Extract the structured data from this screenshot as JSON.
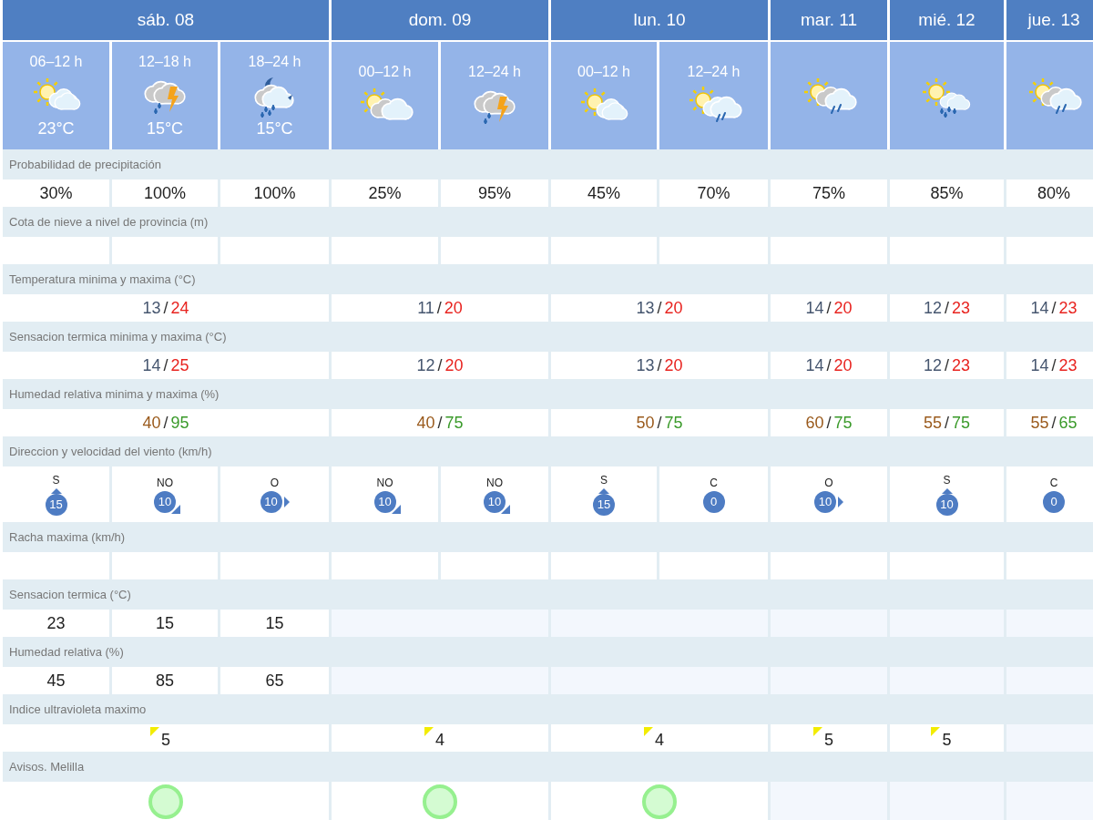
{
  "days": [
    {
      "label": "sáb. 08",
      "periods": [
        {
          "time": "06–12 h",
          "kind": "sun_cloud",
          "temp": "23°C"
        },
        {
          "time": "12–18 h",
          "kind": "storm",
          "temp": "15°C"
        },
        {
          "time": "18–24 h",
          "kind": "night_rain",
          "temp": "15°C"
        }
      ]
    },
    {
      "label": "dom. 09",
      "periods": [
        {
          "time": "00–12 h",
          "kind": "sun_grey_cloud"
        },
        {
          "time": "12–24 h",
          "kind": "storm"
        }
      ]
    },
    {
      "label": "lun. 10",
      "periods": [
        {
          "time": "00–12 h",
          "kind": "sun_cloud"
        },
        {
          "time": "12–24 h",
          "kind": "sun_cloud_rain"
        }
      ]
    },
    {
      "label": "mar. 11",
      "periods": [
        {
          "kind": "sun_grey_cloud_rain"
        }
      ]
    },
    {
      "label": "mié. 12",
      "periods": [
        {
          "kind": "sun_cloud_showers"
        }
      ]
    },
    {
      "label": "jue. 13",
      "periods": [
        {
          "kind": "sun_grey_cloud_rain"
        }
      ]
    }
  ],
  "rows": [
    {
      "label": "Probabilidad de precipitación",
      "kind": "periods",
      "days": [
        {
          "available": true,
          "values": [
            "30%",
            "100%",
            "100%"
          ]
        },
        {
          "available": true,
          "values": [
            "25%",
            "95%"
          ]
        },
        {
          "available": true,
          "values": [
            "45%",
            "70%"
          ]
        },
        {
          "available": true,
          "values": [
            "75%"
          ]
        },
        {
          "available": true,
          "values": [
            "85%"
          ]
        },
        {
          "available": true,
          "values": [
            "80%"
          ]
        }
      ]
    },
    {
      "label": "Cota de nieve a nivel de provincia (m)",
      "kind": "periods",
      "days": [
        {
          "available": true
        },
        {
          "available": true
        },
        {
          "available": true
        },
        {
          "available": true
        },
        {
          "available": true
        },
        {
          "available": true
        }
      ]
    },
    {
      "label": "Temperatura minima y maxima (°C)",
      "kind": "temperature_range",
      "days": [
        {
          "available": true,
          "min": "13",
          "sep": "/",
          "max": "24"
        },
        {
          "available": true,
          "min": "11",
          "sep": "/",
          "max": "20"
        },
        {
          "available": true,
          "min": "13",
          "sep": "/",
          "max": "20"
        },
        {
          "available": true,
          "min": "14",
          "sep": "/",
          "max": "20"
        },
        {
          "available": true,
          "min": "12",
          "sep": "/",
          "max": "23"
        },
        {
          "available": true,
          "min": "14",
          "sep": "/",
          "max": "23"
        }
      ]
    },
    {
      "label": "Sensacion termica minima y maxima (°C)",
      "kind": "temperature_range",
      "days": [
        {
          "available": true,
          "min": "14",
          "sep": "/",
          "max": "25"
        },
        {
          "available": true,
          "min": "12",
          "sep": "/",
          "max": "20"
        },
        {
          "available": true,
          "min": "13",
          "sep": "/",
          "max": "20"
        },
        {
          "available": true,
          "min": "14",
          "sep": "/",
          "max": "20"
        },
        {
          "available": true,
          "min": "12",
          "sep": "/",
          "max": "23"
        },
        {
          "available": true,
          "min": "14",
          "sep": "/",
          "max": "23"
        }
      ]
    },
    {
      "label": "Humedad relativa minima y maxima (%)",
      "kind": "humidity_range",
      "days": [
        {
          "available": true,
          "min": "40",
          "sep": "/",
          "max": "95"
        },
        {
          "available": true,
          "min": "40",
          "sep": "/",
          "max": "75"
        },
        {
          "available": true,
          "min": "50",
          "sep": "/",
          "max": "75"
        },
        {
          "available": true,
          "min": "60",
          "sep": "/",
          "max": "75"
        },
        {
          "available": true,
          "min": "55",
          "sep": "/",
          "max": "75"
        },
        {
          "available": true,
          "min": "55",
          "sep": "/",
          "max": "65"
        }
      ]
    },
    {
      "label": "Direccion y velocidad del viento (km/h)",
      "kind": "wind",
      "days": [
        {
          "available": true,
          "winds": [
            {
              "direction": "S",
              "speed": "15",
              "kind": "up"
            },
            {
              "direction": "NO",
              "speed": "10",
              "kind": "down_right"
            },
            {
              "direction": "O",
              "speed": "10",
              "kind": "right"
            }
          ]
        },
        {
          "available": true,
          "winds": [
            {
              "direction": "NO",
              "speed": "10",
              "kind": "down_right"
            },
            {
              "direction": "NO",
              "speed": "10",
              "kind": "down_right"
            }
          ]
        },
        {
          "available": true,
          "winds": [
            {
              "direction": "S",
              "speed": "15",
              "kind": "up"
            },
            {
              "direction": "C",
              "speed": "0",
              "kind": "calm"
            }
          ]
        },
        {
          "available": true,
          "winds": [
            {
              "direction": "O",
              "speed": "10",
              "kind": "right"
            }
          ]
        },
        {
          "available": true,
          "winds": [
            {
              "direction": "S",
              "speed": "10",
              "kind": "up"
            }
          ]
        },
        {
          "available": true,
          "winds": [
            {
              "direction": "C",
              "speed": "0",
              "kind": "calm"
            }
          ]
        }
      ]
    },
    {
      "label": "Racha maxima (km/h)",
      "kind": "periods",
      "days": [
        {
          "available": true
        },
        {
          "available": true
        },
        {
          "available": true
        },
        {
          "available": true
        },
        {
          "available": true
        },
        {
          "available": true
        }
      ]
    },
    {
      "label": "Sensacion termica (°C)",
      "kind": "periods",
      "days": [
        {
          "available": true,
          "values": [
            "23",
            "15",
            "15"
          ]
        },
        {
          "available": false
        },
        {
          "available": false
        },
        {
          "available": false
        },
        {
          "available": false
        },
        {
          "available": false
        }
      ]
    },
    {
      "label": "Humedad relativa (%)",
      "kind": "periods",
      "days": [
        {
          "available": true,
          "values": [
            "45",
            "85",
            "65"
          ]
        },
        {
          "available": false
        },
        {
          "available": false
        },
        {
          "available": false
        },
        {
          "available": false
        },
        {
          "available": false
        }
      ]
    },
    {
      "label": "Indice ultravioleta maximo",
      "kind": "uv",
      "days": [
        {
          "available": true,
          "value": "5"
        },
        {
          "available": true,
          "value": "4"
        },
        {
          "available": true,
          "value": "4"
        },
        {
          "available": true,
          "value": "5"
        },
        {
          "available": true,
          "value": "5"
        },
        {
          "available": false
        }
      ]
    },
    {
      "label": "Avisos. Melilla",
      "kind": "warning",
      "days": [
        {
          "available": true
        },
        {
          "available": true
        },
        {
          "available": true
        },
        {
          "available": false
        },
        {
          "available": false
        },
        {
          "available": false
        }
      ]
    }
  ]
}
